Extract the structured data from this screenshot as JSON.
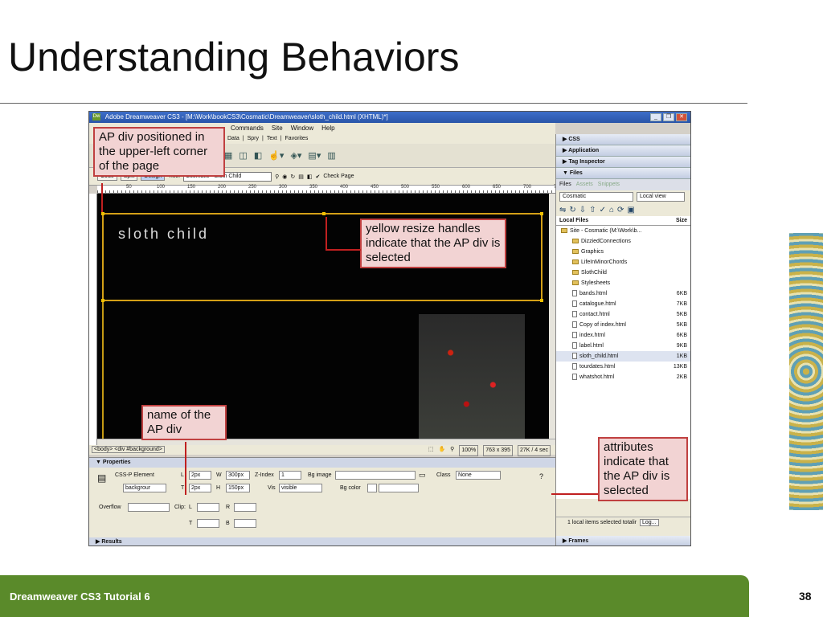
{
  "slide": {
    "title": "Understanding Behaviors",
    "footer_left": "Dreamweaver CS3 Tutorial 6",
    "page_number": "38"
  },
  "window": {
    "logo": "Dw",
    "title": "Adobe Dreamweaver CS3 - [M:\\Work\\bookCS3\\Cosmatic\\Dreamweaver\\sloth_child.html (XHTML)*]",
    "buttons": [
      "_",
      "❐",
      "✕"
    ]
  },
  "menubar": [
    "Commands",
    "Site",
    "Window",
    "Help"
  ],
  "insert_tabs": [
    "Data",
    "Spry",
    "Text",
    "Favorites"
  ],
  "docbar": {
    "code": "Code",
    "split": "Split",
    "design": "Design",
    "title_label": "Title:",
    "title_value": "Cosmatic - Sloth Child",
    "check_page": "Check Page",
    "win_ctrl": "_ ❐ ✕"
  },
  "ruler": [
    "50",
    "100",
    "150",
    "200",
    "250",
    "300",
    "350",
    "400",
    "450",
    "500",
    "550",
    "600",
    "650",
    "700",
    "75"
  ],
  "canvas": {
    "sloth_text": "sloth child"
  },
  "statusbar": {
    "tags": "<body> <div #background>",
    "zoom": "100%",
    "size": "763 x 395",
    "weight": "27K / 4 sec"
  },
  "properties": {
    "header": "Properties",
    "element": "CSS-P Element",
    "element_value": "backgrour",
    "L_label": "L",
    "L_value": "2px",
    "T_label": "T",
    "T_value": "2px",
    "W_label": "W",
    "W_value": "300px",
    "H_label": "H",
    "H_value": "150px",
    "zindex_label": "Z-Index",
    "zindex_value": "1",
    "vis_label": "Vis",
    "vis_value": "visible",
    "bgimage_label": "Bg image",
    "bgcolor_label": "Bg color",
    "class_label": "Class",
    "class_value": "None",
    "overflow_label": "Overflow",
    "clip_label": "Clip:",
    "clip_L": "L",
    "clip_R": "R",
    "clip_T": "T",
    "clip_B": "B"
  },
  "results": "Results",
  "right_panel": {
    "css": "CSS",
    "application": "Application",
    "tag_inspector": "Tag Inspector",
    "files_header": "Files",
    "tabs": [
      "Files",
      "Assets",
      "Snippets"
    ],
    "site_select": "Cosmatic",
    "view_select": "Local view",
    "local_files": "Local Files",
    "size": "Size",
    "tree": [
      {
        "name": "Site - Cosmatic (M:\\Work\\b...",
        "size": "",
        "indent": 0,
        "type": "folder"
      },
      {
        "name": "DizziedConnections",
        "size": "",
        "indent": 1,
        "type": "folder"
      },
      {
        "name": "Graphics",
        "size": "",
        "indent": 1,
        "type": "folder"
      },
      {
        "name": "LifeInMinorChords",
        "size": "",
        "indent": 1,
        "type": "folder"
      },
      {
        "name": "SlothChild",
        "size": "",
        "indent": 1,
        "type": "folder"
      },
      {
        "name": "Stylesheets",
        "size": "",
        "indent": 1,
        "type": "folder"
      },
      {
        "name": "bands.html",
        "size": "6KB",
        "indent": 1,
        "type": "file"
      },
      {
        "name": "catalogue.html",
        "size": "7KB",
        "indent": 1,
        "type": "file"
      },
      {
        "name": "contact.html",
        "size": "5KB",
        "indent": 1,
        "type": "file"
      },
      {
        "name": "Copy of index.html",
        "size": "5KB",
        "indent": 1,
        "type": "file"
      },
      {
        "name": "index.html",
        "size": "6KB",
        "indent": 1,
        "type": "file"
      },
      {
        "name": "label.html",
        "size": "9KB",
        "indent": 1,
        "type": "file"
      },
      {
        "name": "sloth_child.html",
        "size": "1KB",
        "indent": 1,
        "type": "file",
        "selected": true
      },
      {
        "name": "tourdates.html",
        "size": "13KB",
        "indent": 1,
        "type": "file"
      },
      {
        "name": "whatshot.html",
        "size": "2KB",
        "indent": 1,
        "type": "file"
      }
    ],
    "status": "1 local items selected totalir",
    "log": "Log...",
    "frames": "Frames"
  },
  "callouts": {
    "ap_position": "AP div positioned in the upper-left corner of the page",
    "resize_handles": "yellow resize handles indicate that the AP div is selected",
    "name_of_div": "name of the AP div",
    "attributes": "attributes indicate that the AP div is selected"
  },
  "colors": {
    "callout_fill": "#f2d3d3",
    "callout_border": "#c04040",
    "footer_green": "#5a8a2a",
    "ap_border": "#d4a017"
  }
}
